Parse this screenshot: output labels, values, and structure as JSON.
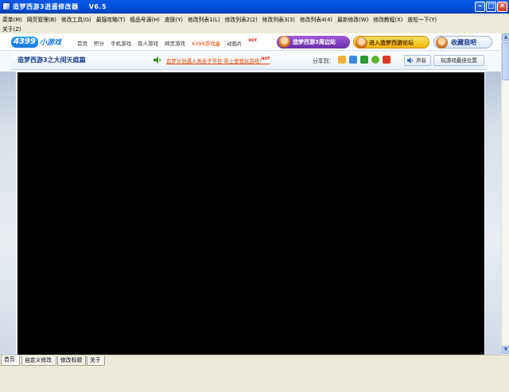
{
  "window": {
    "title": "造梦西游3逍遥修改器    V6.5",
    "controls": {
      "minimize": "–",
      "maximize": "□",
      "close": "✕"
    }
  },
  "menu": {
    "row1": [
      "菜单(M)",
      "网页管理(B)",
      "修改工具(G)",
      "最强攻略(T)",
      "极品号源(H)",
      "皮肤(Y)",
      "修改列表1(L)",
      "修改列表2(2)",
      "修改列表3(3)",
      "修改列表4(4)",
      "最新修改(W)",
      "修改教程(X)",
      "放松一下(Y)"
    ],
    "row2": [
      "关于(Z)"
    ]
  },
  "site": {
    "logo_num": "4399",
    "logo_text": "小游戏",
    "nav": [
      "首页",
      "积分",
      "手机游戏",
      "双人游戏",
      "网页游戏",
      "4399游戏盒",
      "动画片"
    ],
    "hot_badge": "HOT",
    "btn_zhoubian": "造梦西游3周边站",
    "btn_forum": "进入造梦西游论坛",
    "btn_favorite": "收藏我吧"
  },
  "game": {
    "title": "造梦西游3之大闹天庭篇",
    "notice": "造梦计划遇人类亲子节目 带上爸爸玩游戏!",
    "notice_hot": "HOT",
    "share_label": "分享到：",
    "sound_label": "声音",
    "best_position_label": "玩游戏最佳位置"
  },
  "tabs": [
    "首页",
    "自定义修改",
    "修改标题",
    "关于"
  ],
  "colors": {
    "titlebar": "#0053e0",
    "accent_orange": "#e04a00",
    "link_blue": "#1a3e8a",
    "game_bg": "#000000"
  }
}
